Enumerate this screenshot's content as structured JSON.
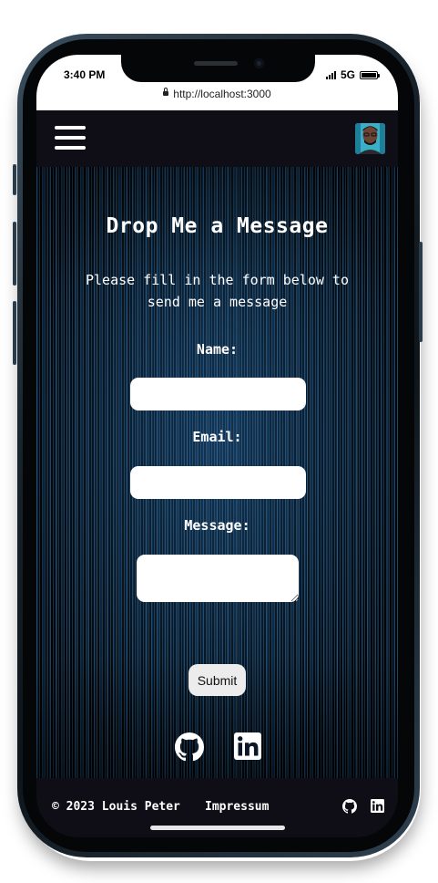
{
  "status_bar": {
    "time": "3:40 PM",
    "network": "5G",
    "address": "http://localhost:3000"
  },
  "nav": {
    "menu_icon": "hamburger-menu-icon",
    "avatar": "profile-avatar"
  },
  "form": {
    "title": "Drop Me a Message",
    "subtitle": "Please fill in the form below to send me a message",
    "name_label": "Name:",
    "name_value": "",
    "email_label": "Email:",
    "email_value": "",
    "message_label": "Message:",
    "message_value": "",
    "submit_label": "Submit"
  },
  "social": [
    {
      "icon": "github-icon"
    },
    {
      "icon": "linkedin-icon"
    }
  ],
  "footer": {
    "copyright": "© 2023 Louis Peter",
    "impressum": "Impressum"
  },
  "colors": {
    "nav_bg": "#0f0e16",
    "text": "#ffffff",
    "background": "#0a1624"
  }
}
